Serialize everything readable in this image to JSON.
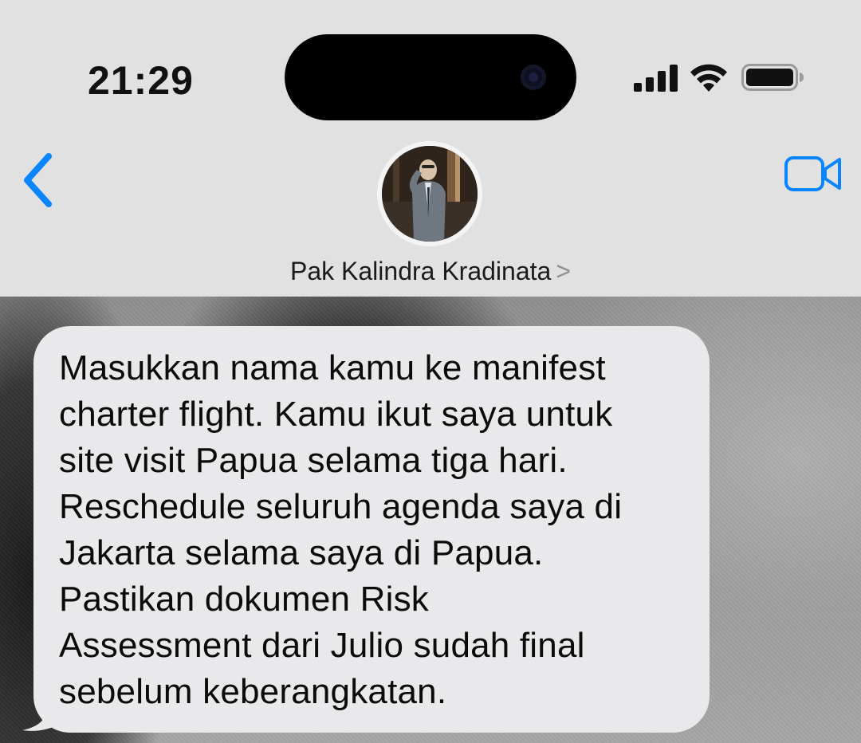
{
  "status_bar": {
    "time": "21:29",
    "icons": [
      "signal-icon",
      "wifi-icon",
      "battery-icon"
    ]
  },
  "nav": {
    "back_icon": "chevron-left-icon",
    "video_icon": "video-camera-icon",
    "contact_name": "Pak Kalindra Kradinata",
    "contact_chevron": ">"
  },
  "colors": {
    "accent": "#0a84ff",
    "header_bg": "#e1e1e1",
    "bubble_bg": "#e9e9eb",
    "text": "#0b0b0b"
  },
  "messages": [
    {
      "direction": "incoming",
      "text": "Masukkan nama kamu ke manifest\ncharter flight. Kamu ikut saya untuk\nsite visit Papua selama tiga hari.\nReschedule seluruh agenda saya di\nJakarta selama saya di Papua.\nPastikan dokumen Risk\nAssessment dari Julio sudah final\nsebelum keberangkatan."
    }
  ]
}
